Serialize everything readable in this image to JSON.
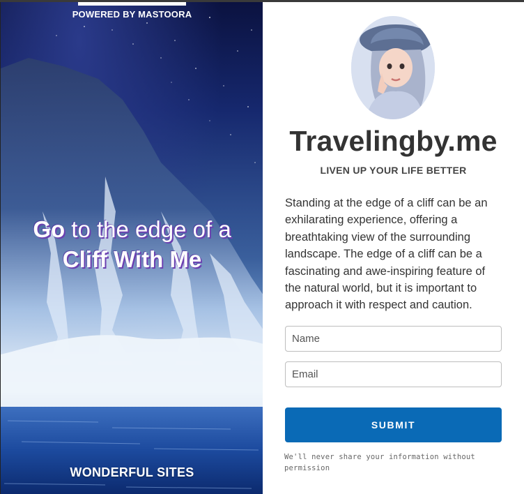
{
  "hero": {
    "powered_by": "POWERED BY MASTOORA",
    "headline_bold_1": "Go",
    "headline_light": " to the edge of a",
    "headline_bold_2": "Cliff With Me",
    "footer_label": "WONDERFUL SITES"
  },
  "profile": {
    "site_title": "Travelingby.me",
    "tagline": "LIVEN UP YOUR LIFE BETTER",
    "description": "Standing at the edge of a cliff can be an exhilarating experience, offering a breathtaking view of the surrounding landscape. The edge of a cliff can be a fascinating and awe-inspiring feature of the natural world, but it is important to approach it with respect and caution."
  },
  "form": {
    "name_placeholder": "Name",
    "email_placeholder": "Email",
    "submit_label": "SUBMIT",
    "privacy_note": "We'll never share your information without permission"
  },
  "colors": {
    "accent": "#0a6ab6",
    "title_text": "#333333"
  }
}
